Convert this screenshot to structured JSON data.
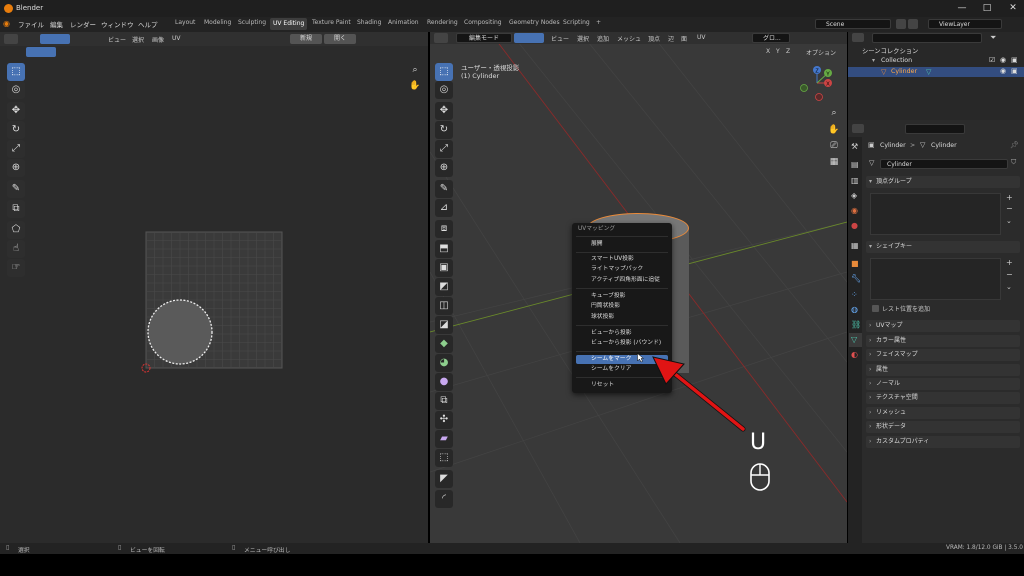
{
  "window": {
    "title": "Blender",
    "controls": [
      "—",
      "□",
      "✕"
    ]
  },
  "menubar": {
    "items": [
      "ファイル",
      "編集",
      "レンダー",
      "ウィンドウ",
      "ヘルプ"
    ]
  },
  "workspaces": [
    "Layout",
    "Modeling",
    "Sculpting",
    "UV Editing",
    "Texture Paint",
    "Shading",
    "Animation",
    "Rendering",
    "Compositing",
    "Geometry Nodes",
    "Scripting"
  ],
  "workspace_add": "+",
  "scene": {
    "name": "Scene",
    "viewlayer": "ViewLayer"
  },
  "uv_header": {
    "menus": [
      "ビュー",
      "選択",
      "画像",
      "UV"
    ],
    "new_label": "新規",
    "open_label": "開く"
  },
  "vp_header": {
    "mode": "編集モード",
    "menus": [
      "ビュー",
      "選択",
      "追加",
      "メッシュ",
      "頂点",
      "辺",
      "面",
      "UV"
    ],
    "transform": "グロ...",
    "axes": [
      "X",
      "Y",
      "Z"
    ],
    "options": "オプション"
  },
  "viewport": {
    "label1": "ユーザー・透視投影",
    "label2": "(1) Cylinder"
  },
  "gizmo": {
    "x": "X",
    "y": "Y",
    "z": "Z"
  },
  "context_menu": {
    "title": "UVマッピング",
    "items": [
      "展開",
      "スマートUV投影",
      "ライトマップパック",
      "アクティブ四角形面に追従",
      "キューブ投影",
      "円筒状投影",
      "球状投影",
      "ビューから投影",
      "ビューから投影 (バウンド)",
      "シームをマーク",
      "シームをクリア",
      "リセット"
    ],
    "highlighted": "シームをマーク"
  },
  "overlay": {
    "key": "U"
  },
  "outliner": {
    "title": "シーンコレクション",
    "collection": "Collection",
    "object": "Cylinder"
  },
  "properties": {
    "breadcrumb_obj": "Cylinder",
    "breadcrumb_sep": ">",
    "breadcrumb_mesh": "Cylinder",
    "mesh_name": "Cylinder",
    "panels_open": [
      "頂点グループ",
      "シェイプキー"
    ],
    "relative_label": "レスト位置を追加",
    "panels_closed": [
      "UVマップ",
      "カラー属性",
      "フェイスマップ",
      "属性",
      "ノーマル",
      "テクスチャ空間",
      "リメッシュ",
      "形状データ",
      "カスタムプロパティ"
    ]
  },
  "statusbar": {
    "select": "選択",
    "rotate": "ビューを回転",
    "menu": "メニュー呼び出し",
    "vram": "VRAM: 1.8/12.0 GiB | 3.5.0"
  },
  "colors": {
    "accent": "#4772b3",
    "brand": "#e87d0d",
    "arrow": "#e01414"
  }
}
